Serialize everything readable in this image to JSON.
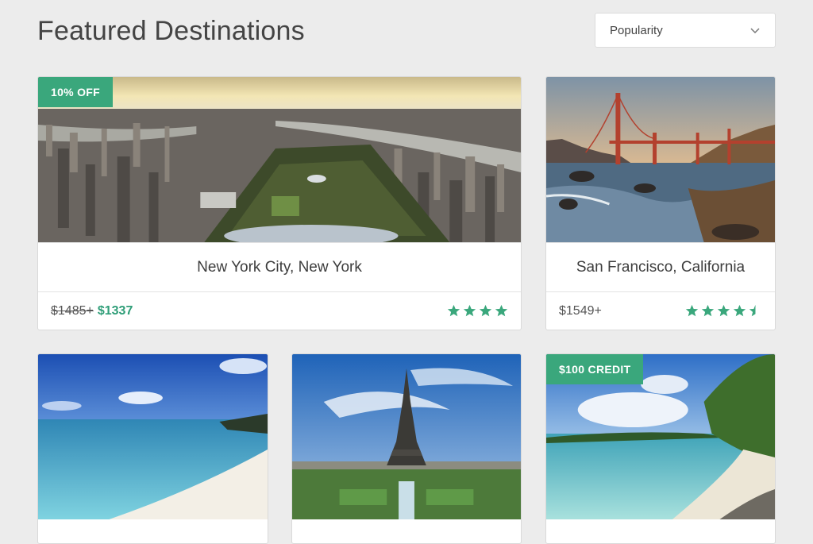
{
  "header": {
    "title": "Featured Destinations"
  },
  "sort": {
    "selected": "Popularity"
  },
  "cards": [
    {
      "name": "New York City, New York",
      "badge": "10% OFF",
      "price_old": "$1485+",
      "price_new": "$1337",
      "rating": 4,
      "image": "new-york-aerial"
    },
    {
      "name": "San Francisco, California",
      "badge": "",
      "price": "$1549+",
      "rating": 4.5,
      "image": "golden-gate-bridge"
    },
    {
      "name": "",
      "badge": "",
      "image": "tropical-beach"
    },
    {
      "name": "",
      "badge": "",
      "image": "eiffel-tower"
    },
    {
      "name": "",
      "badge": "$100 CREDIT",
      "image": "caribbean-cove"
    }
  ],
  "colors": {
    "accent": "#3aa77c",
    "price_new": "#2f9e78",
    "background": "#ececec"
  }
}
